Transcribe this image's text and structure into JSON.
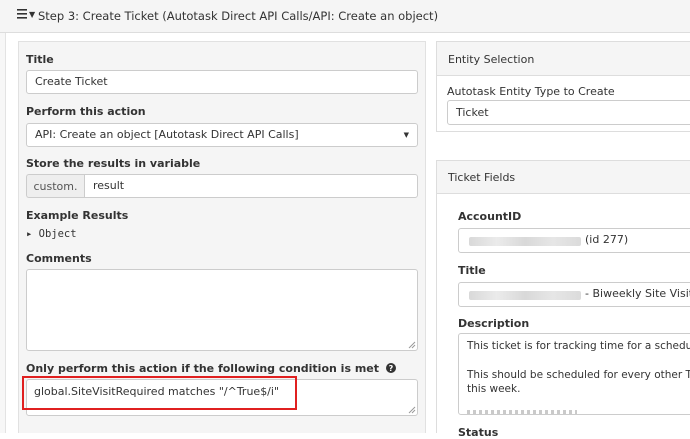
{
  "header": {
    "menu_icon": "hamburger-icon",
    "caret_icon": "caret-down-icon",
    "title": "Step 3: Create Ticket (Autotask Direct API Calls/API: Create an object)"
  },
  "left_panel": {
    "title_label": "Title",
    "title_value": "Create Ticket",
    "action_label": "Perform this action",
    "action_value": "API: Create an object [Autotask Direct API Calls]",
    "store_label": "Store the results in variable",
    "store_prefix": "custom.",
    "store_value": "result",
    "example_label": "Example Results",
    "example_value": "▸ Object",
    "comments_label": "Comments",
    "comments_value": "",
    "condition_label": "Only perform this action if the following condition is met",
    "condition_help_icon": "question-circle-icon",
    "condition_value": "global.SiteVisitRequired matches \"/^True$/i\""
  },
  "entity_selection": {
    "heading": "Entity Selection",
    "type_label": "Autotask Entity Type to Create",
    "type_value": "Ticket"
  },
  "ticket_fields": {
    "heading": "Ticket Fields",
    "account_label": "AccountID",
    "account_suffix": "(id 277)",
    "title_label": "Title",
    "title_suffix": "- Biweekly Site Visit (",
    "description_label": "Description",
    "description_line1": "This ticket is for tracking time for a schedule",
    "description_line2": "This should be scheduled for every other Thu",
    "description_line3": "this week.",
    "status_label": "Status"
  },
  "colors": {
    "highlight_box": "#e02020",
    "panel_bg": "#f5f5f5",
    "border": "#cccccc"
  }
}
